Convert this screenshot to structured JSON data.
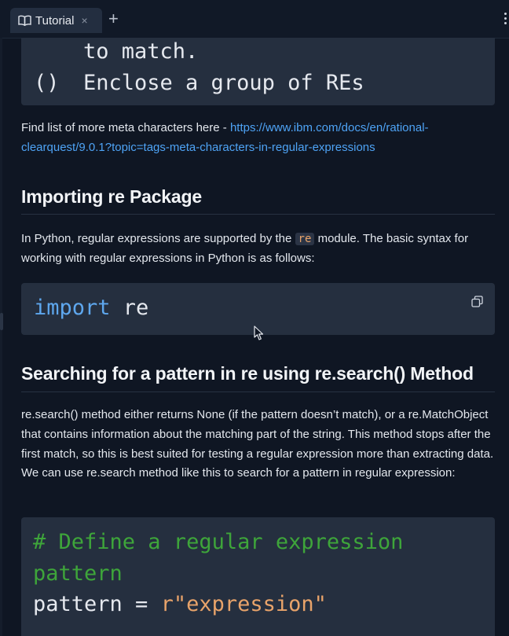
{
  "tab": {
    "title": "Tutorial",
    "close": "×",
    "new_tab": "+"
  },
  "meta_table": {
    "row1_text": "to match.",
    "row2_symbol": "()",
    "row2_text": "Enclose a group of REs"
  },
  "meta_link_para": {
    "prefix": "Find list of more meta characters here - ",
    "link": "https://www.ibm.com/docs/en/rational-clearquest/9.0.1?topic=tags-meta-characters-in-regular-expressions"
  },
  "section_import": {
    "heading": "Importing re Package",
    "text_before": "In Python, regular expressions are supported by the ",
    "inline_code": "re",
    "text_after": " module. The basic syntax for working with regular expressions in Python is as follows:",
    "code_keyword": "import",
    "code_rest": " re",
    "copy_icon": "copy-icon"
  },
  "section_search": {
    "heading": "Searching for a pattern in re using re.search() Method",
    "paragraph": "re.search() method either returns None (if the pattern doesn’t match), or a re.MatchObject that contains information about the matching part of the string. This method stops after the first match, so this is best suited for testing a regular expression more than extracting data. We can use re.search method like this to search for a pattern in regular expression:",
    "code_comment_1": "# Define a regular expression",
    "code_comment_2": "pattern",
    "code_var": "pattern",
    "code_op": " = ",
    "code_str": "r\"expression\""
  },
  "colors": {
    "background": "#0f1623",
    "code_bg": "#252f3f",
    "link": "#4ea3f5",
    "keyword": "#5ea7ee",
    "comment": "#3ea53a",
    "string": "#e8a36a"
  }
}
